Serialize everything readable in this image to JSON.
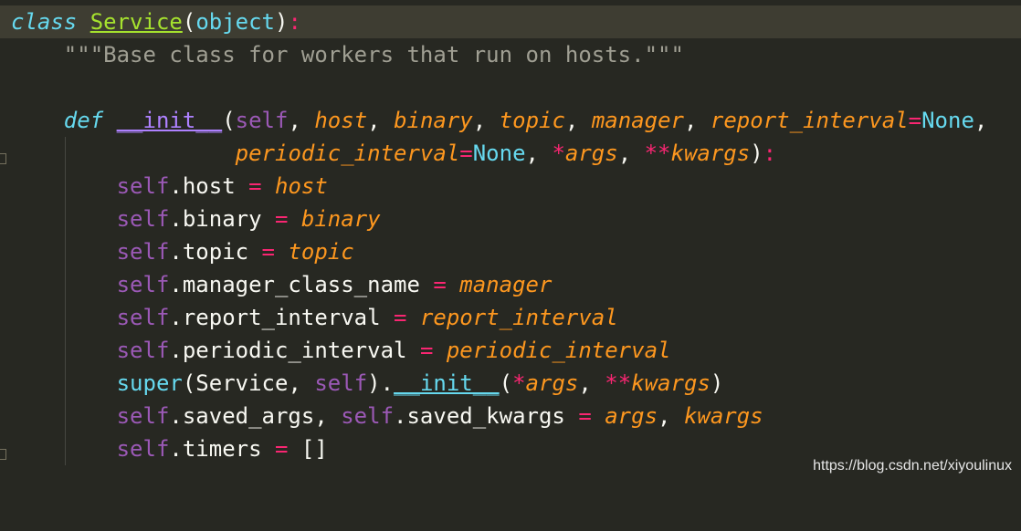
{
  "lines": [
    {
      "t": [
        "class",
        " ",
        "Service",
        "(",
        "object",
        ")",
        ":"
      ]
    },
    {
      "t": [
        "    \"\"\"Base class for workers that run on hosts.\"\"\""
      ]
    },
    {
      "t": [
        ""
      ]
    },
    {
      "t": [
        "    ",
        "def",
        " ",
        "__init__",
        "(",
        "self",
        ", ",
        "host",
        ", ",
        "binary",
        ", ",
        "topic",
        ", ",
        "manager",
        ", ",
        "report_interval",
        "=",
        "None",
        ","
      ]
    },
    {
      "t": [
        "                 ",
        "periodic_interval",
        "=",
        "None",
        ", ",
        "*",
        "args",
        ", ",
        "**",
        "kwargs",
        ")",
        ":"
      ]
    },
    {
      "t": [
        "        ",
        "self",
        ".host ",
        "=",
        " ",
        "host"
      ]
    },
    {
      "t": [
        "        ",
        "self",
        ".binary ",
        "=",
        " ",
        "binary"
      ]
    },
    {
      "t": [
        "        ",
        "self",
        ".topic ",
        "=",
        " ",
        "topic"
      ]
    },
    {
      "t": [
        "        ",
        "self",
        ".manager_class_name ",
        "=",
        " ",
        "manager"
      ]
    },
    {
      "t": [
        "        ",
        "self",
        ".report_interval ",
        "=",
        " ",
        "report_interval"
      ]
    },
    {
      "t": [
        "        ",
        "self",
        ".periodic_interval ",
        "=",
        " ",
        "periodic_interval"
      ]
    },
    {
      "t": [
        "        ",
        "super",
        "(Service, ",
        "self",
        ").",
        "__init__",
        "(",
        "*",
        "args",
        ", ",
        "**",
        "kwargs",
        ")"
      ]
    },
    {
      "t": [
        "        ",
        "self",
        ".saved_args, ",
        "self",
        ".saved_kwargs ",
        "=",
        " ",
        "args",
        ", ",
        "kwargs"
      ]
    },
    {
      "t": [
        "        ",
        "self",
        ".timers ",
        "=",
        " []"
      ]
    }
  ],
  "watermark": "https://blog.csdn.net/xiyoulinux"
}
